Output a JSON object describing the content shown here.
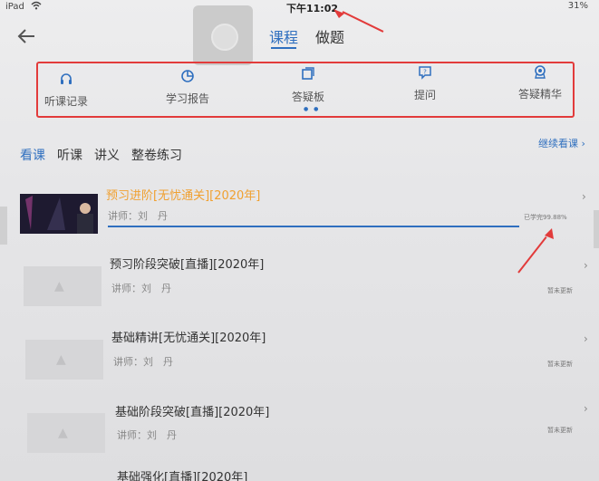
{
  "status_bar": {
    "carrier": "iPad",
    "time": "下午11:02",
    "battery": "31%"
  },
  "header": {
    "tabs": [
      "课程",
      "做题"
    ]
  },
  "quick_menu": [
    {
      "label": "听课记录",
      "icon": "headphones-icon"
    },
    {
      "label": "学习报告",
      "icon": "report-icon"
    },
    {
      "label": "答疑板",
      "icon": "board-icon"
    },
    {
      "label": "提问",
      "icon": "question-icon"
    },
    {
      "label": "答疑精华",
      "icon": "badge-icon"
    }
  ],
  "sub_tabs": [
    "看课",
    "听课",
    "讲义",
    "整卷练习"
  ],
  "continue_label": "继续看课",
  "courses": [
    {
      "title": "预习进阶[无忧通关][2020年]",
      "teacher": "讲师：刘　丹",
      "status": "已学完99.88%",
      "progress": 99.88,
      "active": true
    },
    {
      "title": "预习阶段突破[直播][2020年]",
      "teacher": "讲师：刘　丹",
      "status": "暂未更新",
      "progress": 0,
      "active": false
    },
    {
      "title": "基础精讲[无忧通关][2020年]",
      "teacher": "讲师：刘　丹",
      "status": "暂未更新",
      "progress": 0,
      "active": false
    },
    {
      "title": "基础阶段突破[直播][2020年]",
      "teacher": "讲师：刘　丹",
      "status": "暂未更新",
      "progress": 0,
      "active": false
    },
    {
      "title": "基础强化[直播][2020年]",
      "teacher": "",
      "status": "",
      "progress": 0,
      "active": false
    }
  ],
  "colors": {
    "accent": "#2f6fbf",
    "highlight": "#f0a030",
    "annotation": "#e23b3b"
  }
}
